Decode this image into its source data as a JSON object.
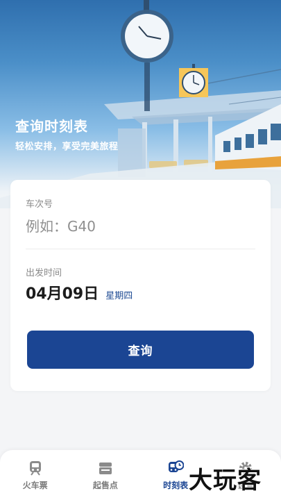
{
  "hero": {
    "title": "查询时刻表",
    "subtitle": "轻松安排，享受完美旅程"
  },
  "form": {
    "train_label": "车次号",
    "train_placeholder": "例如：G40",
    "train_value": "",
    "date_label": "出发时间",
    "date_value": "04月09日",
    "weekday": "星期四",
    "query_button": "查询"
  },
  "tabbar": {
    "items": [
      {
        "label": "火车票",
        "icon": "train-icon",
        "active": false
      },
      {
        "label": "起售点",
        "icon": "ticket-icon",
        "active": false
      },
      {
        "label": "时刻表",
        "icon": "train-clock-icon",
        "active": true
      },
      {
        "label": "设置",
        "icon": "gear-icon",
        "active": false
      }
    ]
  },
  "watermark": "大玩客",
  "colors": {
    "primary": "#1b4593",
    "hero_top": "#2f6fae",
    "background": "#f4f5f7",
    "inactive_tab": "#7c7c7c"
  }
}
